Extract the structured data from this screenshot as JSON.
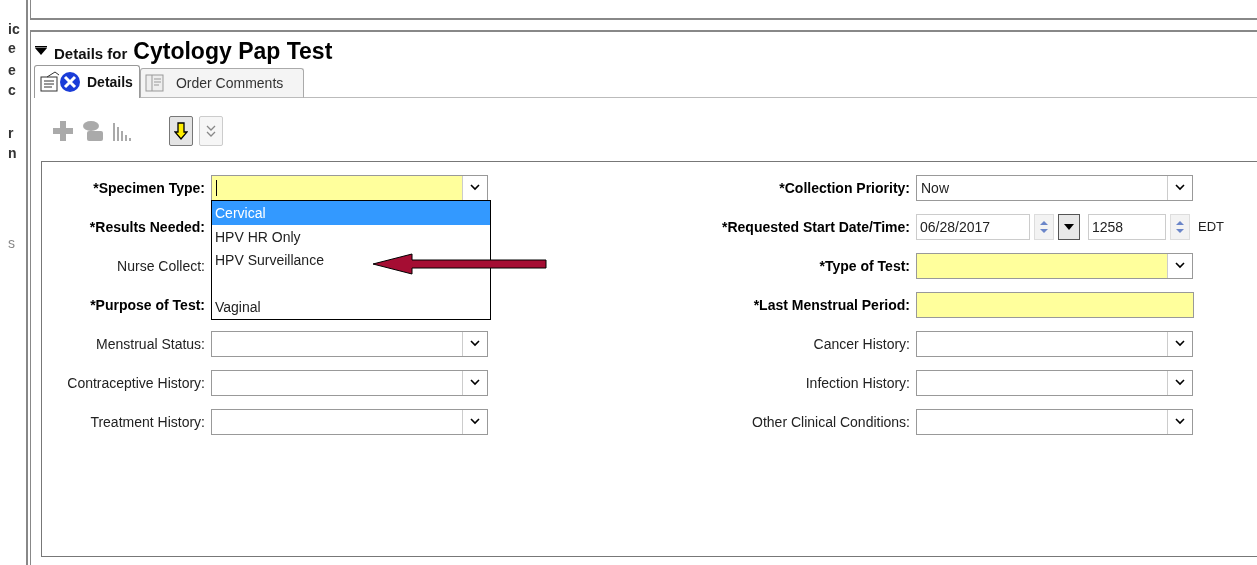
{
  "left_strip": [
    "ic",
    "e",
    "e",
    "c",
    "r",
    "n",
    "s"
  ],
  "header": {
    "prefix": "Details for",
    "title": "Cytology Pap Test",
    "expanded": true
  },
  "tabs": [
    {
      "label": "Details",
      "selected": true,
      "kind": "details"
    },
    {
      "label": "Order Comments",
      "selected": false,
      "kind": "comments"
    }
  ],
  "toolbar": [
    {
      "kind": "plus",
      "disabled": true
    },
    {
      "kind": "pill",
      "disabled": true
    },
    {
      "kind": "chart",
      "disabled": true
    },
    {
      "kind": "down",
      "pressed": true
    },
    {
      "kind": "chevrons",
      "pressed": false
    }
  ],
  "left_fields": [
    {
      "label": "*Specimen Type:",
      "required": true,
      "kind": "combo",
      "highlighted": true,
      "focused": true
    },
    {
      "label": "*Results Needed:",
      "required": true,
      "kind": "covered"
    },
    {
      "label": "Nurse Collect:",
      "required": false,
      "kind": "covered"
    },
    {
      "label": "*Purpose of Test:",
      "required": true,
      "kind": "covered"
    },
    {
      "label": "Menstrual Status:",
      "required": false,
      "kind": "combo",
      "highlighted": false
    },
    {
      "label": "Contraceptive History:",
      "required": false,
      "kind": "combo",
      "highlighted": false
    },
    {
      "label": "Treatment History:",
      "required": false,
      "kind": "combo",
      "highlighted": false
    }
  ],
  "right_fields": [
    {
      "label": "*Collection Priority:",
      "required": true,
      "kind": "combo",
      "highlighted": false,
      "value": "Now"
    },
    {
      "label": "*Requested Start Date/Time:",
      "required": true,
      "kind": "datetime",
      "date": "06/28/2017",
      "time": "1258",
      "zone": "EDT"
    },
    {
      "label": "*Type of Test:",
      "required": true,
      "kind": "combo",
      "highlighted": true
    },
    {
      "label": "*Last Menstrual Period:",
      "required": true,
      "kind": "text",
      "highlighted": true
    },
    {
      "label": "Cancer History:",
      "required": false,
      "kind": "combo",
      "highlighted": false
    },
    {
      "label": "Infection History:",
      "required": false,
      "kind": "combo",
      "highlighted": false
    },
    {
      "label": "Other Clinical Conditions:",
      "required": false,
      "kind": "combo",
      "highlighted": false
    }
  ],
  "dropdown": {
    "options": [
      {
        "kind": "item",
        "label": "Cervical",
        "selected": true
      },
      {
        "kind": "item",
        "label": "HPV HR Only",
        "selected": false
      },
      {
        "kind": "item",
        "label": "HPV Surveillance",
        "selected": false
      },
      {
        "kind": "blank"
      },
      {
        "kind": "item",
        "label": "Vaginal",
        "selected": false
      }
    ]
  }
}
